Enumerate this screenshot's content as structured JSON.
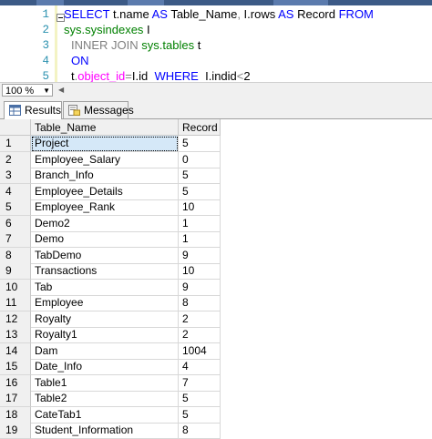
{
  "editor": {
    "line_numbers": [
      "1",
      "2",
      "3",
      "4",
      "5"
    ],
    "line1": {
      "kw1": "SELECT",
      "t1": " t.name ",
      "kw2": "AS",
      "t2": " Table_Name",
      "p1": ",",
      "t3": " I.rows ",
      "kw3": "AS",
      "t4": " Record ",
      "kw4": "FROM"
    },
    "line2": {
      "sys": "sys.sysindexes",
      "t": " I"
    },
    "line3": {
      "kw": "INNER JOIN",
      "t": " ",
      "sys": "sys.tables",
      "t2": " t"
    },
    "line4": {
      "kw": "ON"
    },
    "line5": {
      "t1": "t",
      "p1": ".",
      "fn": "object_id",
      "p2": "=",
      "t2": "I.id  ",
      "kw": "WHERE",
      "t3": "  I.indid",
      "p3": "<",
      "t4": "2"
    }
  },
  "zoom": {
    "value": "100 %"
  },
  "tabs": {
    "results": "Results",
    "messages": "Messages"
  },
  "grid": {
    "headers": {
      "name": "Table_Name",
      "record": "Record"
    },
    "rows": [
      {
        "n": "1",
        "name": "Project",
        "record": "5"
      },
      {
        "n": "2",
        "name": "Employee_Salary",
        "record": "0"
      },
      {
        "n": "3",
        "name": "Branch_Info",
        "record": "5"
      },
      {
        "n": "4",
        "name": "Employee_Details",
        "record": "5"
      },
      {
        "n": "5",
        "name": "Employee_Rank",
        "record": "10"
      },
      {
        "n": "6",
        "name": "Demo2",
        "record": "1"
      },
      {
        "n": "7",
        "name": "Demo",
        "record": "1"
      },
      {
        "n": "8",
        "name": "TabDemo",
        "record": "9"
      },
      {
        "n": "9",
        "name": "Transactions",
        "record": "10"
      },
      {
        "n": "10",
        "name": "Tab",
        "record": "9"
      },
      {
        "n": "11",
        "name": "Employee",
        "record": "8"
      },
      {
        "n": "12",
        "name": "Royalty",
        "record": "2"
      },
      {
        "n": "13",
        "name": "Royalty1",
        "record": "2"
      },
      {
        "n": "14",
        "name": "Dam",
        "record": "1004"
      },
      {
        "n": "15",
        "name": "Date_Info",
        "record": "4"
      },
      {
        "n": "16",
        "name": "Table1",
        "record": "7"
      },
      {
        "n": "17",
        "name": "Table2",
        "record": "5"
      },
      {
        "n": "18",
        "name": "CateTab1",
        "record": "5"
      },
      {
        "n": "19",
        "name": "Student_Information",
        "record": "8"
      }
    ]
  }
}
